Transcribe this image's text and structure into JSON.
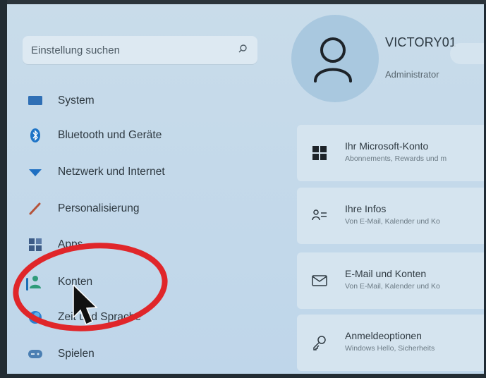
{
  "search": {
    "placeholder": "Einstellung suchen",
    "icon": "search-icon"
  },
  "sidebar": {
    "items": [
      {
        "label": "System",
        "icon": "monitor-icon"
      },
      {
        "label": "Bluetooth und Geräte",
        "icon": "bluetooth-icon"
      },
      {
        "label": "Netzwerk und Internet",
        "icon": "wifi-icon"
      },
      {
        "label": "Personalisierung",
        "icon": "brush-icon"
      },
      {
        "label": "Apps",
        "icon": "apps-icon"
      },
      {
        "label": "Konten",
        "icon": "person-icon",
        "selected": true
      },
      {
        "label": "Zeit und Sprache",
        "icon": "globe-icon"
      },
      {
        "label": "Spielen",
        "icon": "gamepad-icon"
      }
    ]
  },
  "profile": {
    "name": "VICTORY01",
    "role": "Administrator"
  },
  "cards": [
    {
      "title": "Ihr Microsoft-Konto",
      "subtitle": "Abonnements, Rewards und m",
      "icon": "windows-logo-icon"
    },
    {
      "title": "Ihre Infos",
      "subtitle": "Von E-Mail, Kalender und Ko",
      "icon": "user-info-icon"
    },
    {
      "title": "E-Mail und Konten",
      "subtitle": "Von E-Mail, Kalender und Ko",
      "icon": "mail-icon"
    },
    {
      "title": "Anmeldeoptionen",
      "subtitle": "Windows Hello, Sicherheits",
      "icon": "key-icon"
    }
  ],
  "colors": {
    "accent": "#1c6fb5",
    "annotation": "#e0262a"
  }
}
